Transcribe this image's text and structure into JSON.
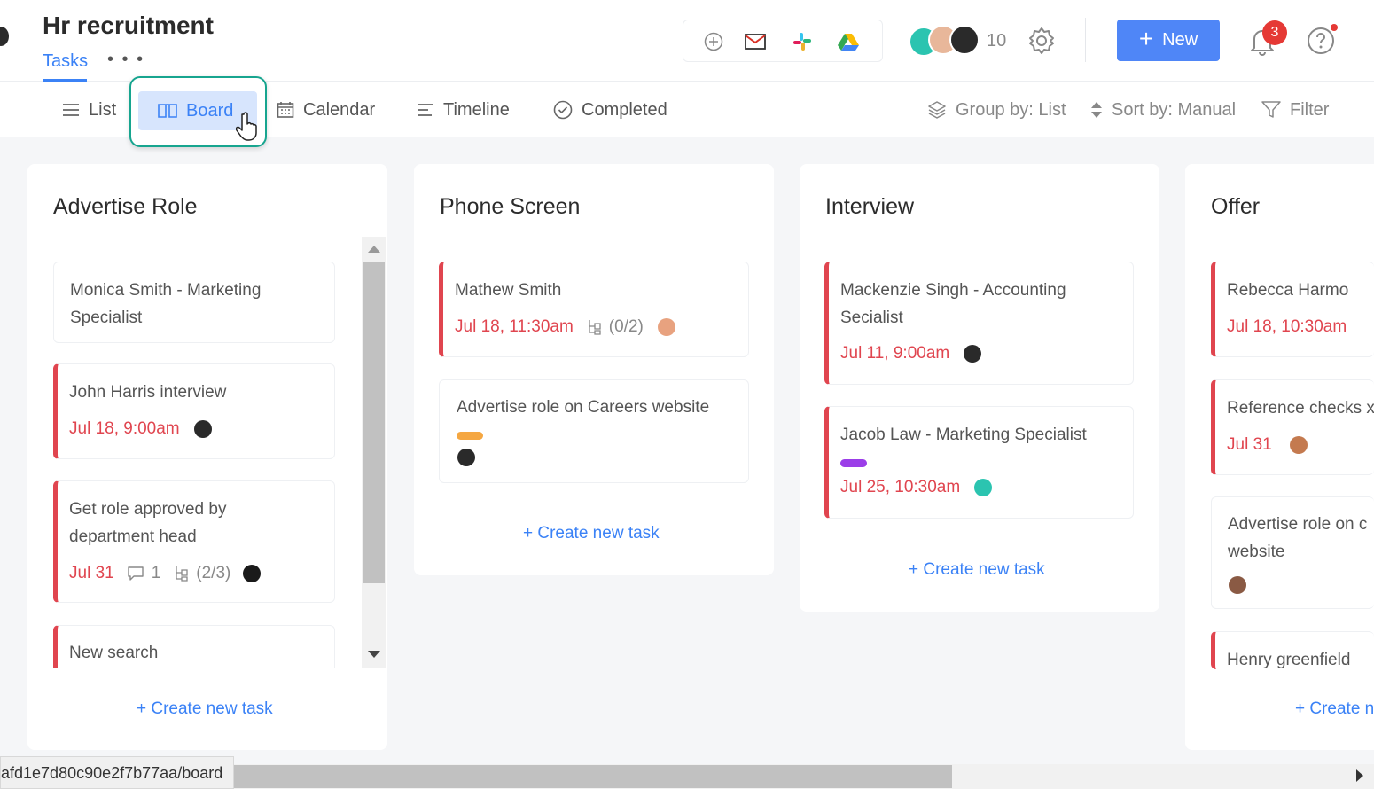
{
  "header": {
    "title": "Hr recruitment",
    "tab_label": "Tasks",
    "more_label": "• • •",
    "integrations": [
      "plus-circle-icon",
      "gmail-icon",
      "slack-icon",
      "google-drive-icon"
    ],
    "member_count": "10",
    "new_button_label": "New",
    "notification_count": "3"
  },
  "viewbar": {
    "views": [
      {
        "label": "List",
        "icon": "list-icon"
      },
      {
        "label": "Board",
        "icon": "board-icon",
        "active": true
      },
      {
        "label": "Calendar",
        "icon": "calendar-icon"
      },
      {
        "label": "Timeline",
        "icon": "timeline-icon"
      },
      {
        "label": "Completed",
        "icon": "check-circle-icon"
      }
    ],
    "group_by": "Group by: List",
    "sort_by": "Sort by: Manual",
    "filter": "Filter"
  },
  "columns": [
    {
      "title": "Advertise Role",
      "cards": [
        {
          "title_line1": "Monica Smith - Marketing",
          "title_line2": "Specialist"
        },
        {
          "title": "John Harris interview",
          "date": "Jul 18, 9:00am"
        },
        {
          "title_line1": "Get role approved by",
          "title_line2": "department head",
          "date": "Jul 31",
          "comments": "1",
          "subtasks": "(2/3)"
        },
        {
          "title": "New search"
        }
      ],
      "create_label": "+ Create new task"
    },
    {
      "title": "Phone Screen",
      "cards": [
        {
          "title": "Mathew Smith",
          "date": "Jul 18, 11:30am",
          "subtasks": "(0/2)"
        },
        {
          "title": "Advertise role on Careers website",
          "tag_color": "#f5a742"
        }
      ],
      "create_label": "+ Create new task"
    },
    {
      "title": "Interview",
      "cards": [
        {
          "title_line1": "Mackenzie Singh - Accounting",
          "title_line2": "Secialist",
          "date": "Jul 11, 9:00am"
        },
        {
          "title": "Jacob Law - Marketing Specialist",
          "date": "Jul 25, 10:30am",
          "tag_color": "#9b3ee8"
        }
      ],
      "create_label": "+ Create new task"
    },
    {
      "title": "Offer",
      "cards": [
        {
          "title": "Rebecca Harmo",
          "date": "Jul 18, 10:30am"
        },
        {
          "title": "Reference checks x",
          "date": "Jul 31"
        },
        {
          "title_line1": "Advertise role on c",
          "title_line2": "website"
        },
        {
          "title": "Henry greenfield"
        }
      ],
      "create_label": "+ Create n"
    }
  ],
  "status_url": "afd1e7d80c90e2f7b77aa/board",
  "colors": {
    "accent": "#3b82f6",
    "urgent": "#e0454f",
    "teal": "#17a58f"
  }
}
